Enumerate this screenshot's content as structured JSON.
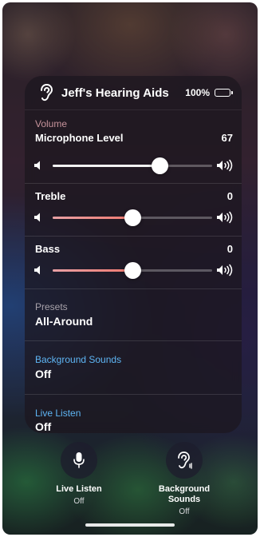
{
  "header": {
    "device_name": "Jeff's Hearing Aids",
    "battery": "100%",
    "icon": "ear-icon"
  },
  "volume": {
    "category": "Volume",
    "title": "Microphone Level",
    "value": "67",
    "level_percent": 67
  },
  "treble": {
    "title": "Treble",
    "value": "0",
    "level_percent": 50
  },
  "bass": {
    "title": "Bass",
    "value": "0",
    "level_percent": 50
  },
  "presets": {
    "label": "Presets",
    "value": "All-Around"
  },
  "background_sounds": {
    "label": "Background Sounds",
    "value": "Off"
  },
  "live_listen": {
    "label": "Live Listen",
    "value": "Off"
  },
  "bottom_controls": [
    {
      "label": "Live Listen",
      "status": "Off",
      "icon": "microphone-icon"
    },
    {
      "label": "Background\nSounds",
      "status": "Off",
      "icon": "ear-wave-icon"
    }
  ],
  "colors": {
    "category_text": "#c7939b",
    "link_blue": "#5fb6f5",
    "panel_bg": "#1c161e"
  }
}
